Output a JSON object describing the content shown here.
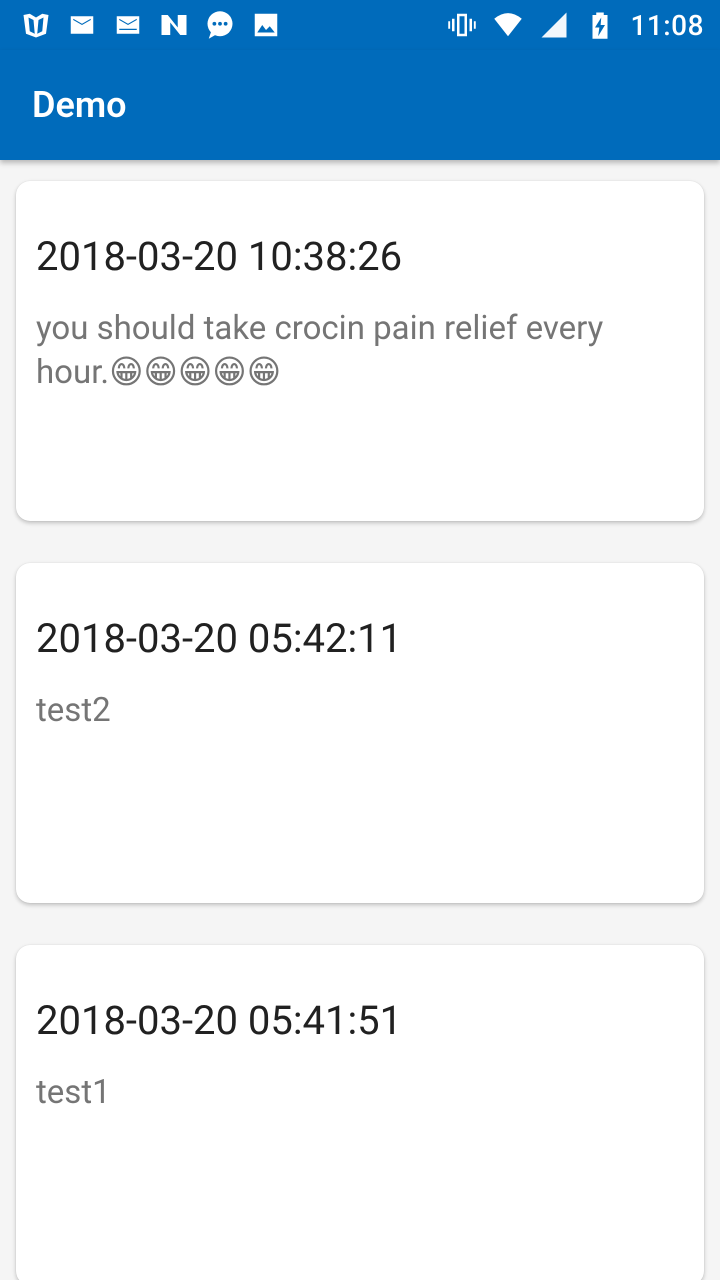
{
  "status_bar": {
    "left_icons": [
      "shield-app-icon",
      "mail-icon",
      "mail-alt-icon",
      "n-app-icon",
      "chat-bubble-icon",
      "image-icon"
    ],
    "right_icons": [
      "vibrate-icon",
      "wifi-icon",
      "signal-icon",
      "battery-charging-icon"
    ],
    "time": "11:08"
  },
  "app_bar": {
    "title": "Demo"
  },
  "notes": [
    {
      "time": "2018-03-20 10:38:26",
      "message": "you should take crocin pain relief every hour.😁😁😁😁😁"
    },
    {
      "time": "2018-03-20 05:42:11",
      "message": "test2"
    },
    {
      "time": "2018-03-20 05:41:51",
      "message": "test1"
    }
  ],
  "colors": {
    "primary": "#006bbb",
    "background": "#f5f5f5",
    "card": "#ffffff",
    "title_text": "#212121",
    "body_text": "#757575"
  }
}
